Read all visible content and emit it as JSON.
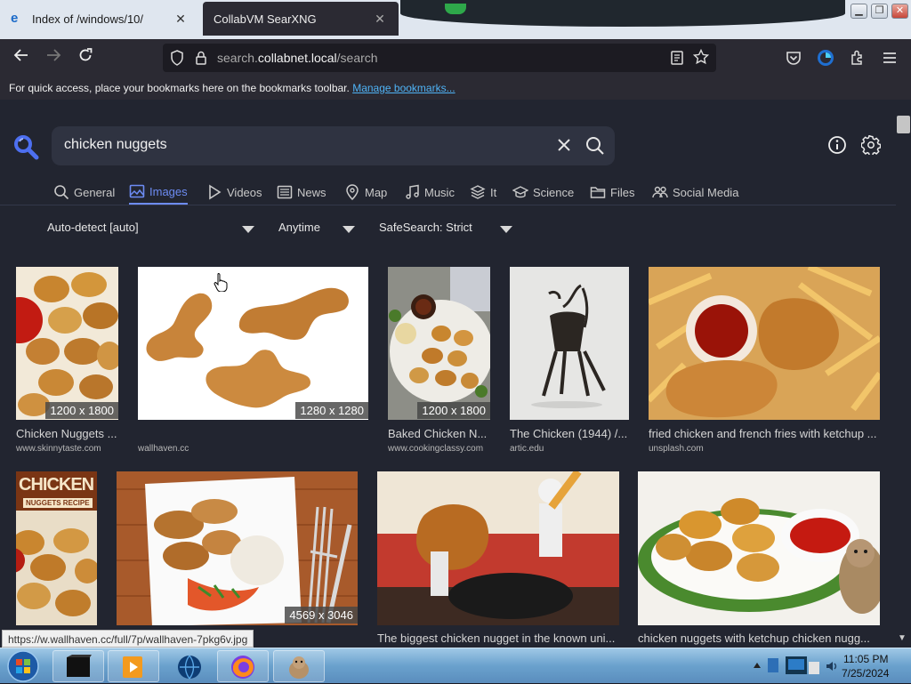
{
  "browser": {
    "tabs": [
      {
        "title": "Index of /windows/10/",
        "active": false
      },
      {
        "title": "CollabVM SearXNG",
        "active": true
      }
    ],
    "url": {
      "prefix": "search.",
      "host": "collabnet.local",
      "path": "/search"
    },
    "bookmarks_bar": {
      "message": "For quick access, place your bookmarks here on the bookmarks toolbar.",
      "link": "Manage bookmarks..."
    },
    "status_url": "https://w.wallhaven.cc/full/7p/wallhaven-7pkg6v.jpg"
  },
  "search": {
    "query": "chicken nuggets",
    "accent": "#6d8cf3",
    "categories": [
      {
        "label": "General",
        "icon": "search-icon",
        "active": false
      },
      {
        "label": "Images",
        "icon": "image-icon",
        "active": true
      },
      {
        "label": "Videos",
        "icon": "play-icon",
        "active": false
      },
      {
        "label": "News",
        "icon": "newspaper-icon",
        "active": false
      },
      {
        "label": "Map",
        "icon": "map-pin-icon",
        "active": false
      },
      {
        "label": "Music",
        "icon": "music-note-icon",
        "active": false
      },
      {
        "label": "It",
        "icon": "layers-icon",
        "active": false
      },
      {
        "label": "Science",
        "icon": "graduation-cap-icon",
        "active": false
      },
      {
        "label": "Files",
        "icon": "folder-icon",
        "active": false
      },
      {
        "label": "Social Media",
        "icon": "people-icon",
        "active": false
      }
    ],
    "filters": {
      "language": "Auto-detect [auto]",
      "time": "Anytime",
      "safesearch": "SafeSearch: Strict"
    }
  },
  "results": [
    {
      "title": "Chicken Nuggets ...",
      "source": "www.skinnytaste.com",
      "dims": "1200 x 1800"
    },
    {
      "title": "",
      "source": "wallhaven.cc",
      "dims": "1280 x 1280"
    },
    {
      "title": "Baked Chicken N...",
      "source": "www.cookingclassy.com",
      "dims": "1200 x 1800"
    },
    {
      "title": "The Chicken (1944) /...",
      "source": "artic.edu",
      "dims": ""
    },
    {
      "title": "fried chicken and french fries with ketchup ...",
      "source": "unsplash.com",
      "dims": ""
    },
    {
      "title": "",
      "source": "",
      "dims": "",
      "overlay_text": [
        "CHICKEN",
        "NUGGETS RECIPE"
      ]
    },
    {
      "title": "",
      "source": "",
      "dims": "4569 x 3046"
    },
    {
      "title": "The biggest chicken nugget in the known uni...",
      "source": "",
      "dims": ""
    },
    {
      "title": "chicken nuggets with ketchup chicken nugg...",
      "source": "",
      "dims": ""
    }
  ],
  "taskbar": {
    "time": "11:05 PM",
    "date": "7/25/2024"
  }
}
